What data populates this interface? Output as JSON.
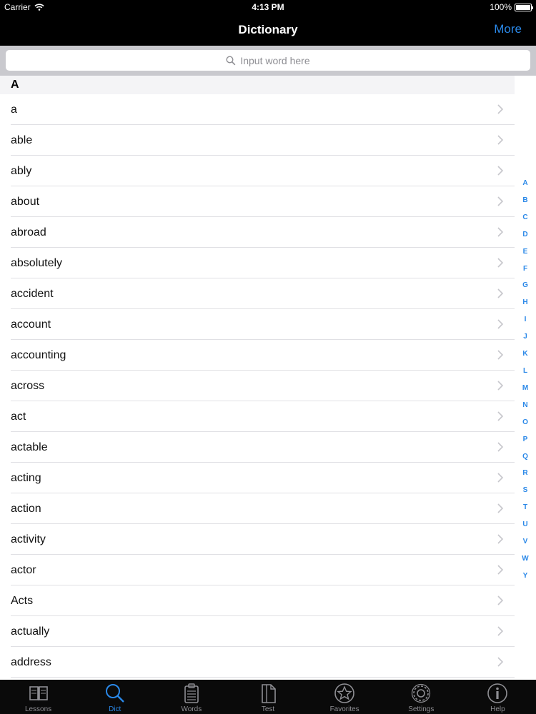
{
  "status_bar": {
    "carrier": "Carrier",
    "time": "4:13 PM",
    "battery": "100%",
    "battery_level": 1.0
  },
  "nav": {
    "title": "Dictionary",
    "more": "More"
  },
  "search": {
    "placeholder": "Input word here"
  },
  "section": "A",
  "words": [
    "a",
    "able",
    "ably",
    "about",
    "abroad",
    "absolutely",
    "accident",
    "account",
    "accounting",
    "across",
    "act",
    "actable",
    "acting",
    "action",
    "activity",
    "actor",
    "Acts",
    "actually",
    "address"
  ],
  "index_letters": [
    "A",
    "B",
    "C",
    "D",
    "E",
    "F",
    "G",
    "H",
    "I",
    "J",
    "K",
    "L",
    "M",
    "N",
    "O",
    "P",
    "Q",
    "R",
    "S",
    "T",
    "U",
    "V",
    "W",
    "Y"
  ],
  "tabs": [
    {
      "label": "Lessons",
      "icon": "book-icon",
      "active": false
    },
    {
      "label": "Dict",
      "icon": "search-icon",
      "active": true
    },
    {
      "label": "Words",
      "icon": "clipboard-icon",
      "active": false
    },
    {
      "label": "Test",
      "icon": "document-icon",
      "active": false
    },
    {
      "label": "Favorites",
      "icon": "star-icon",
      "active": false
    },
    {
      "label": "Settings",
      "icon": "gear-icon",
      "active": false
    },
    {
      "label": "Help",
      "icon": "info-icon",
      "active": false
    }
  ],
  "colors": {
    "accent": "#2a88e8",
    "bar": "#000000",
    "search_bg": "#c9c9ce"
  }
}
